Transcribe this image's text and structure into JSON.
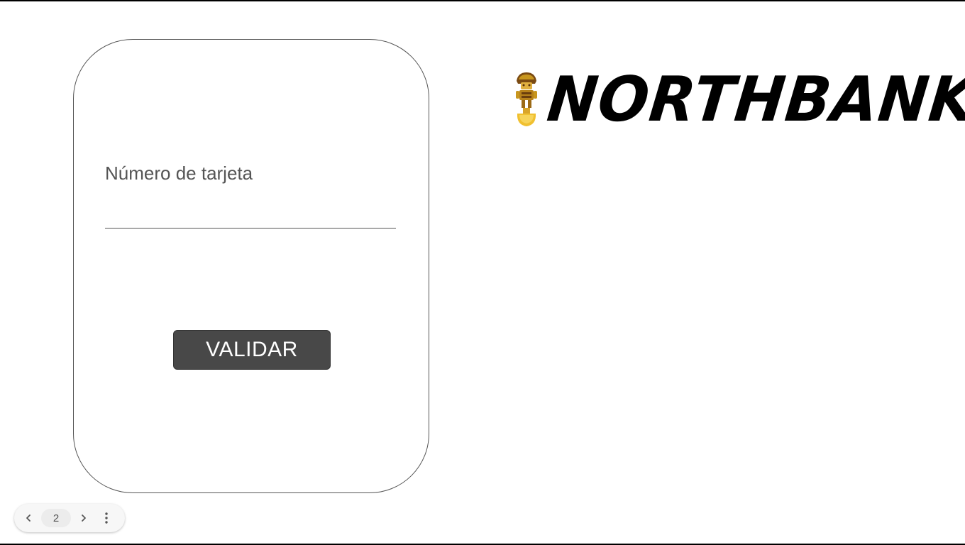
{
  "form": {
    "field_label": "Número de tarjeta",
    "card_number_value": "",
    "validate_label": "VALIDAR"
  },
  "brand": {
    "logo_text": "NORTHBANK",
    "logo_icon": "tumi-icon"
  },
  "pager": {
    "current_page": "2",
    "prev_icon": "chevron-left-icon",
    "next_icon": "chevron-right-icon",
    "more_icon": "more-vert-icon"
  },
  "colors": {
    "button_bg": "#484848",
    "button_text": "#ffffff",
    "label_text": "#555555",
    "logo_text": "#000000",
    "tumi_gold": "#c8961e"
  }
}
